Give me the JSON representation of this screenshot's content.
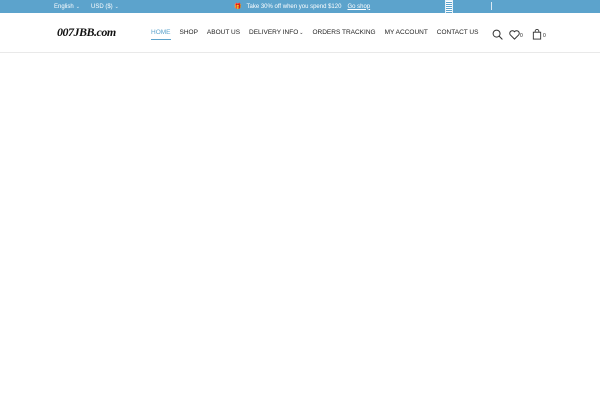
{
  "topbar": {
    "language": "English",
    "currency": "USD ($)",
    "promo_text": "Take 30% off when you spend $120",
    "promo_link": "Go shop",
    "caret_icon": "chevron-down-icon",
    "gift_icon": "gift-icon",
    "flag_icon": "flag-icon"
  },
  "header": {
    "logo": "007JBB.com",
    "nav": [
      {
        "label": "HOME",
        "active": true
      },
      {
        "label": "SHOP"
      },
      {
        "label": "ABOUT US"
      },
      {
        "label": "DELIVERY INFO",
        "has_dropdown": true
      },
      {
        "label": "ORDERS TRACKING"
      },
      {
        "label": "MY ACCOUNT"
      },
      {
        "label": "CONTACT US"
      }
    ],
    "wishlist_count": "0",
    "cart_count": "0"
  },
  "colors": {
    "accent": "#5ca3cc",
    "text": "#222222"
  }
}
